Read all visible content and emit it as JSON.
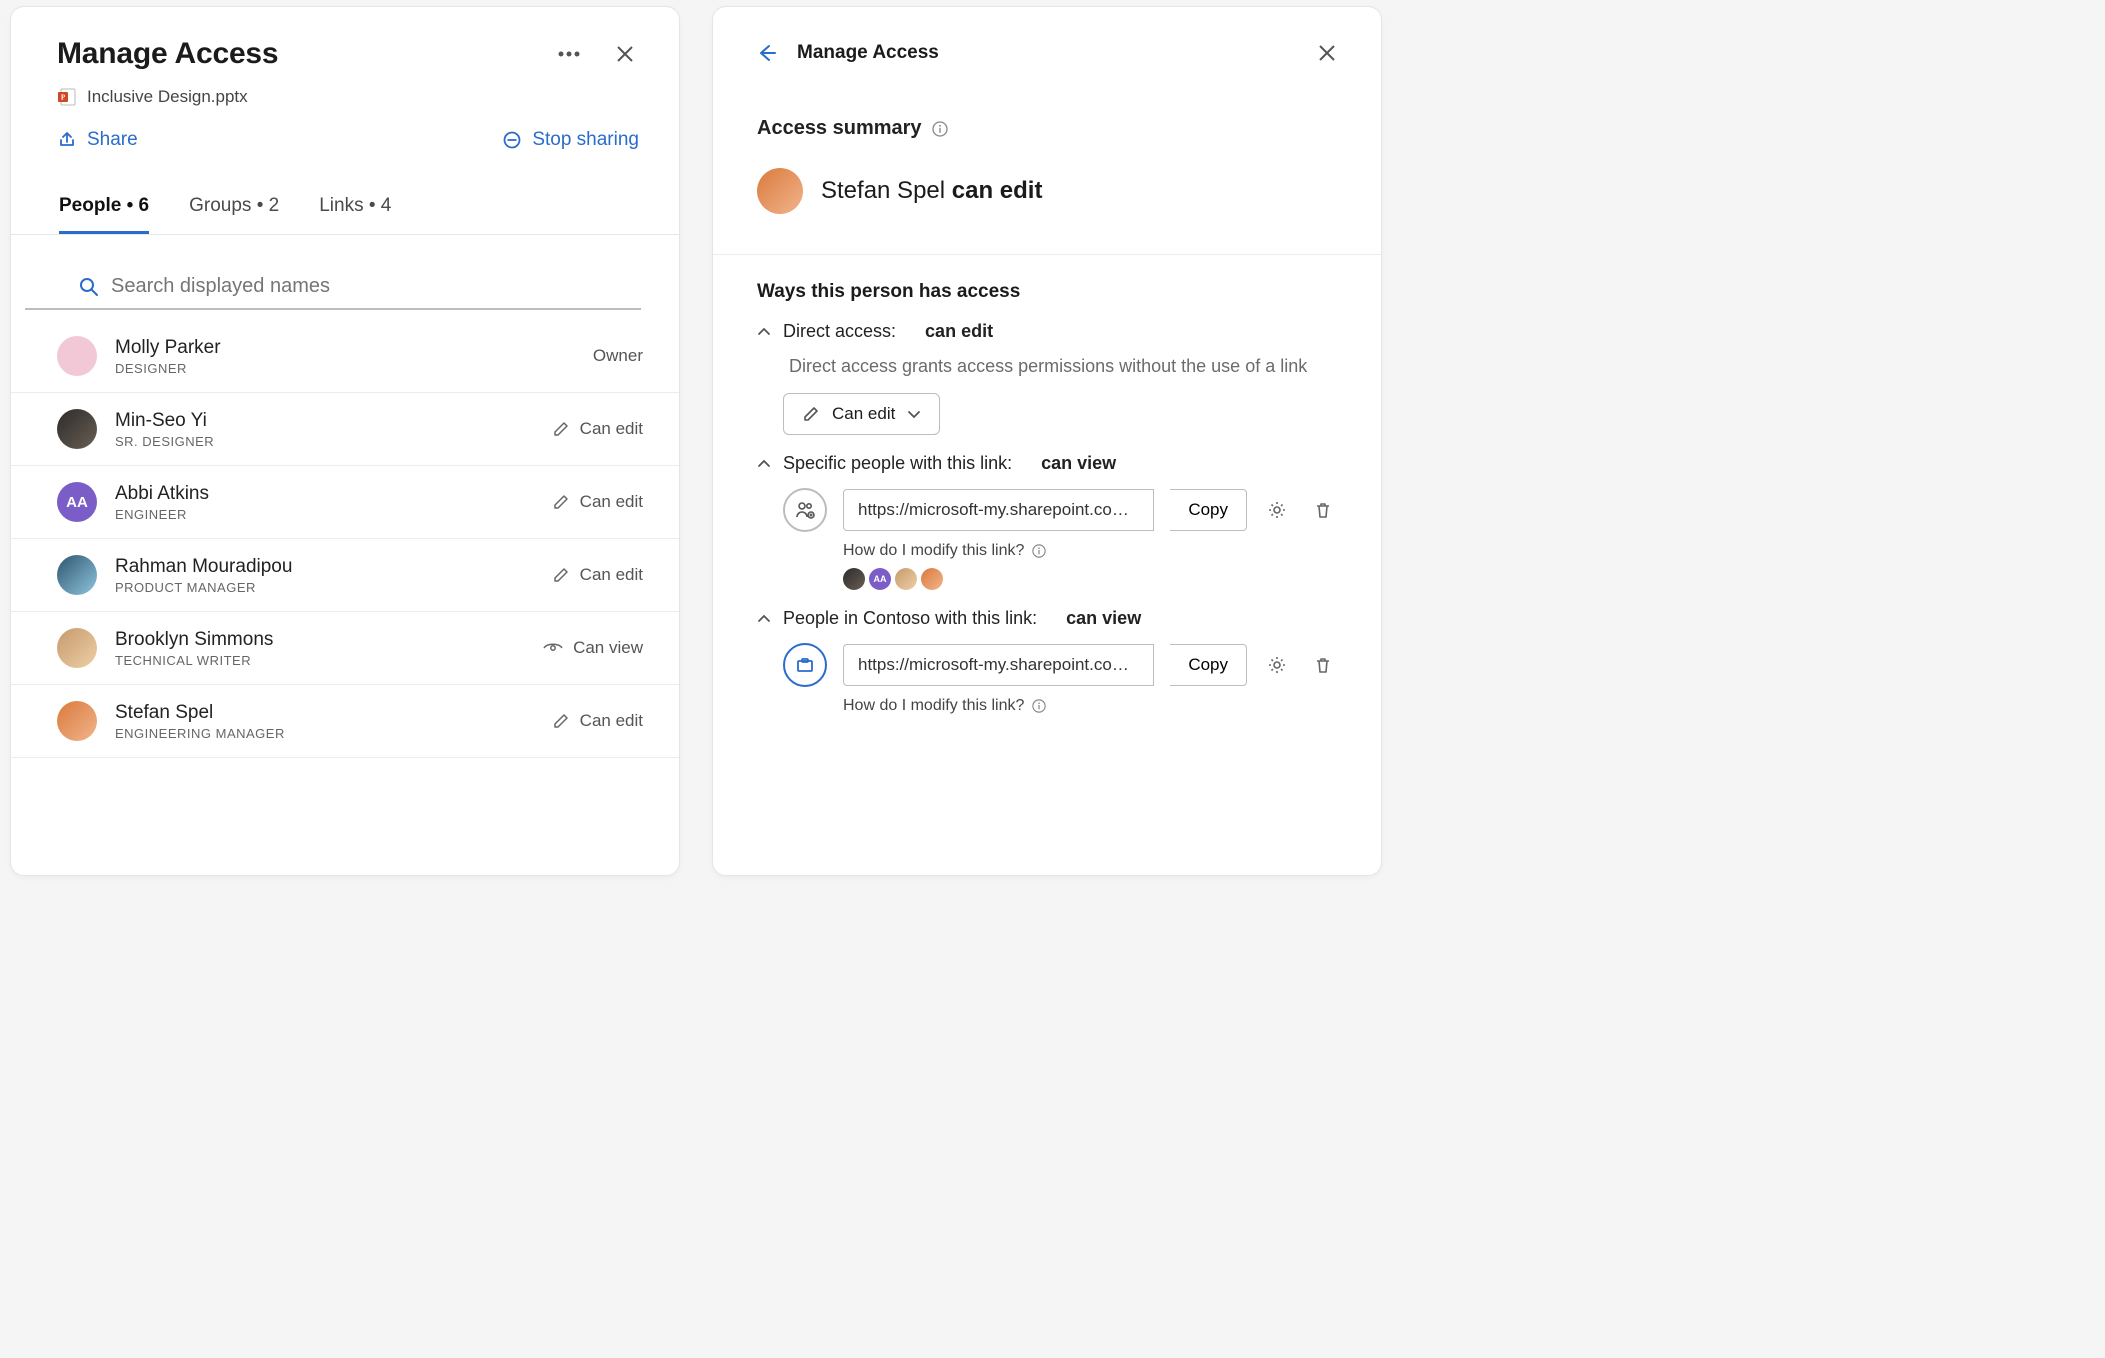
{
  "left": {
    "title": "Manage Access",
    "file_name": "Inclusive Design.pptx",
    "share_label": "Share",
    "stop_sharing_label": "Stop sharing",
    "tabs": {
      "people": {
        "label": "People",
        "count": 6
      },
      "groups": {
        "label": "Groups",
        "count": 2
      },
      "links": {
        "label": "Links",
        "count": 4
      }
    },
    "search_placeholder": "Search displayed names",
    "people": [
      {
        "name": "Molly Parker",
        "role": "DESIGNER",
        "permission": "Owner",
        "perm_icon": "none",
        "avatar_class": "a-pink"
      },
      {
        "name": "Min-Seo Yi",
        "role": "SR. DESIGNER",
        "permission": "Can edit",
        "perm_icon": "edit",
        "avatar_class": "a-photo1"
      },
      {
        "name": "Abbi Atkins",
        "role": "ENGINEER",
        "permission": "Can edit",
        "perm_icon": "edit",
        "avatar_class": "a-purple",
        "initials": "AA"
      },
      {
        "name": "Rahman Mouradipou",
        "role": "PRODUCT MANAGER",
        "permission": "Can edit",
        "perm_icon": "edit",
        "avatar_class": "a-photo2"
      },
      {
        "name": "Brooklyn Simmons",
        "role": "TECHNICAL WRITER",
        "permission": "Can view",
        "perm_icon": "view",
        "avatar_class": "a-photo3"
      },
      {
        "name": "Stefan Spel",
        "role": "ENGINEERING MANAGER",
        "permission": "Can edit",
        "perm_icon": "edit",
        "avatar_class": "a-photo4"
      }
    ]
  },
  "right": {
    "title": "Manage Access",
    "summary_heading": "Access summary",
    "user_name": "Stefan Spel",
    "user_permission": "can edit",
    "ways_heading": "Ways this person has access",
    "direct": {
      "label": "Direct access:",
      "permission": "can edit",
      "description": "Direct access grants access permissions without the use of a link",
      "dropdown_label": "Can edit"
    },
    "link1": {
      "label": "Specific people with this link:",
      "permission": "can view",
      "url": "https://microsoft-my.sharepoint.com...",
      "copy_label": "Copy",
      "help_text": "How do I modify this link?"
    },
    "link2": {
      "label": "People in Contoso with this link:",
      "permission": "can view",
      "url": "https://microsoft-my.sharepoint.com...",
      "copy_label": "Copy",
      "help_text": "How do I modify this link?"
    }
  }
}
